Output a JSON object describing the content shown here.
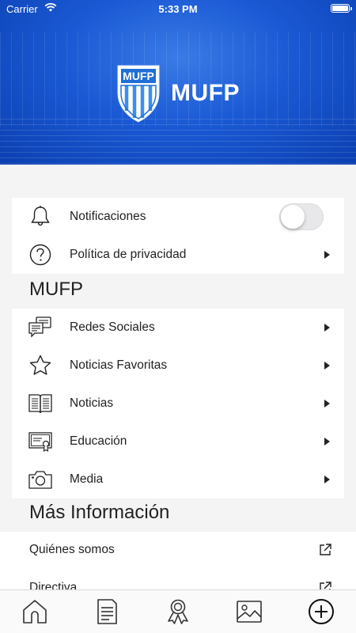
{
  "status_bar": {
    "carrier": "Carrier",
    "time": "5:33 PM"
  },
  "header": {
    "brand_name": "MUFP",
    "logo_text": "MUFP"
  },
  "settings_group": {
    "notifications": {
      "label": "Notificaciones",
      "toggle_on": false
    },
    "privacy": {
      "label": "Política de privacidad"
    }
  },
  "mufp_section": {
    "title": "MUFP",
    "items": [
      {
        "label": "Redes Sociales",
        "icon": "chat-icon"
      },
      {
        "label": "Noticias Favoritas",
        "icon": "star-icon"
      },
      {
        "label": "Noticias",
        "icon": "book-icon"
      },
      {
        "label": "Educación",
        "icon": "certificate-icon"
      },
      {
        "label": "Media",
        "icon": "camera-icon"
      }
    ]
  },
  "info_section": {
    "title": "Más Información",
    "items": [
      {
        "label": "Quiénes somos",
        "icon": "external-link-icon"
      },
      {
        "label": "Directiva",
        "icon": "external-link-icon"
      }
    ]
  },
  "tab_bar": {
    "items": [
      {
        "icon": "home-icon"
      },
      {
        "icon": "document-icon"
      },
      {
        "icon": "award-icon"
      },
      {
        "icon": "image-icon"
      },
      {
        "icon": "plus-circle-icon"
      }
    ]
  },
  "colors": {
    "header_blue": "#1a59d4",
    "logo_blue": "#1f6fd6",
    "background": "#f4f4f4"
  }
}
